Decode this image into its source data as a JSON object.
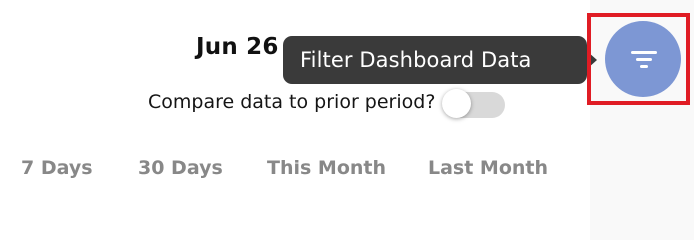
{
  "header": {
    "date_title": "Jun 26"
  },
  "compare": {
    "label": "Compare data to prior period?",
    "enabled": false
  },
  "period_tabs": [
    {
      "label": "7 Days"
    },
    {
      "label": "30 Days"
    },
    {
      "label": "This Month"
    },
    {
      "label": "Last Month"
    }
  ],
  "filter": {
    "tooltip": "Filter Dashboard Data",
    "icon": "filter-lines-icon",
    "button_color": "#7d97d4",
    "highlight_color": "#e01c24"
  }
}
